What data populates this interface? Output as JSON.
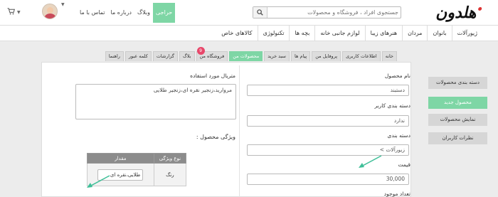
{
  "header": {
    "logo": "هلدون",
    "search_placeholder": "جستجوی افراد ، فروشگاه و محصولات",
    "nav": [
      {
        "label": "حراجی",
        "active": true
      },
      {
        "label": "وبلاگ",
        "active": false
      },
      {
        "label": "درباره ما",
        "active": false
      },
      {
        "label": "تماس با ما",
        "active": false
      }
    ]
  },
  "categories": [
    "ژیورآلات",
    "بانوان",
    "مردان",
    "هنرهای زیبا",
    "لوازم جانبی خانه",
    "بچه ها",
    "تکنولوژی",
    "کالاهای خاص"
  ],
  "tabs": [
    {
      "label": "خانه",
      "active": false
    },
    {
      "label": "اطلاعات کاربری",
      "active": false
    },
    {
      "label": "پروفایل من",
      "active": false
    },
    {
      "label": "پیام ها",
      "active": false
    },
    {
      "label": "سبد خرید",
      "active": false
    },
    {
      "label": "محصولات من",
      "active": true
    },
    {
      "label": "فروشگاه من",
      "active": false,
      "badge": "9"
    },
    {
      "label": "بلاگ",
      "active": false
    },
    {
      "label": "گزارشات",
      "active": false
    },
    {
      "label": "کلمه عبور",
      "active": false
    },
    {
      "label": "راهنما",
      "active": false
    }
  ],
  "sidebar": [
    {
      "label": "دسته بندی محصولات",
      "active": false
    },
    {
      "label": "محصول جدید",
      "active": true
    },
    {
      "label": "نمایش محصولات",
      "active": false
    },
    {
      "label": "نظرات کاربران",
      "active": false
    }
  ],
  "form": {
    "product_name_label": "نام محصول",
    "product_name_value": "دستبند",
    "user_category_label": "دسته بندی کاربر",
    "user_category_value": "ندارد",
    "category_label": "دسته بندی",
    "category_value": "زیورآلات >",
    "price_label": "قیمت",
    "price_value": "30,000",
    "count_label": "تعداد موجود",
    "material_label": "متریال مورد استفاده",
    "material_value": "مروارید،زنجیر نقره ای،زنجیر طلایی",
    "features_label": "ویژگی محصول :",
    "features_headers": [
      "نوع ویژگی",
      "مقدار"
    ],
    "features_row": {
      "type": "رنگ",
      "value": "طلایی،نقره ای"
    }
  },
  "colors": {
    "accent": "#7ed6a5",
    "badge": "#e8476a",
    "table_header": "#8c8c8c"
  }
}
